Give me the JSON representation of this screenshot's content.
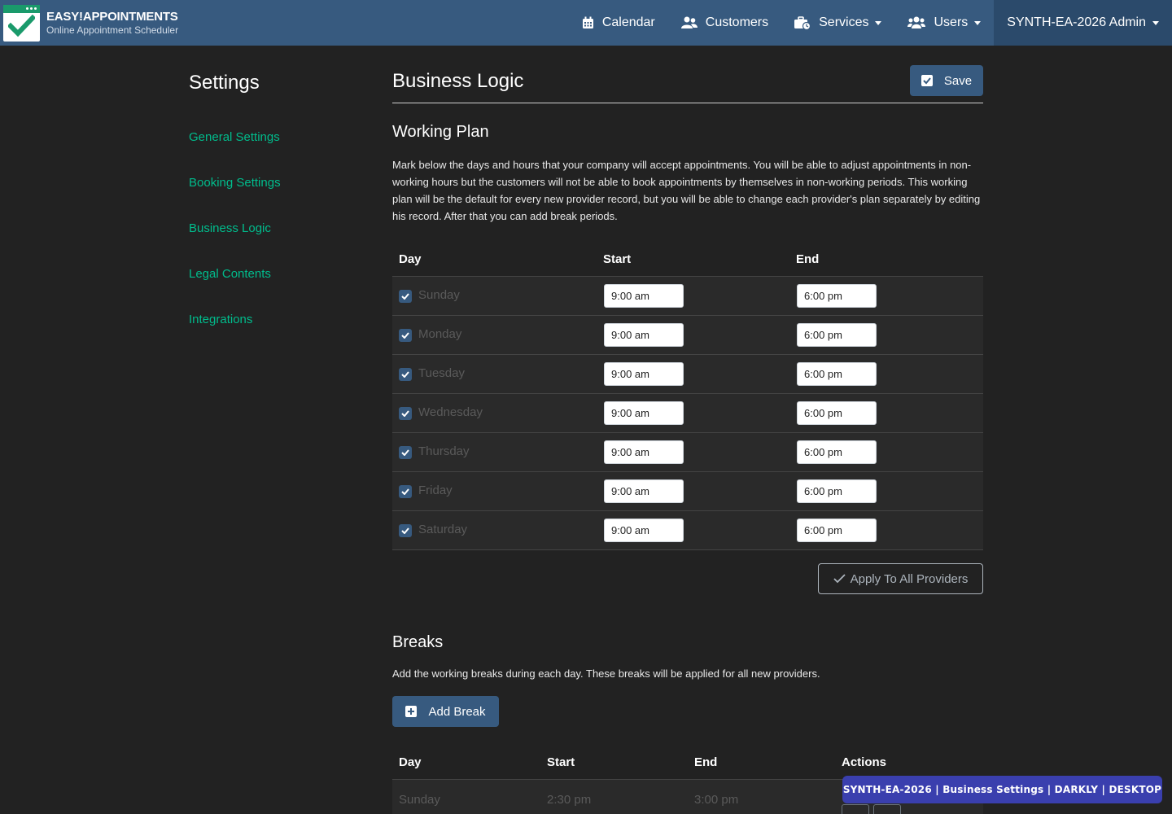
{
  "brand": {
    "title": "EASY!APPOINTMENTS",
    "subtitle": "Online Appointment Scheduler",
    "accent": "#1a9a6b"
  },
  "nav": {
    "items": [
      {
        "label": "Calendar",
        "icon": "calendar-icon",
        "dropdown": false
      },
      {
        "label": "Customers",
        "icon": "users-icon",
        "dropdown": false
      },
      {
        "label": "Services",
        "icon": "business-time-icon",
        "dropdown": true
      },
      {
        "label": "Users",
        "icon": "users-cog-icon",
        "dropdown": true
      },
      {
        "label": "SYNTH-EA-2026 Admin",
        "icon": "",
        "dropdown": true
      }
    ]
  },
  "sidebar": {
    "title": "Settings",
    "items": [
      {
        "label": "General Settings"
      },
      {
        "label": "Booking Settings"
      },
      {
        "label": "Business Logic"
      },
      {
        "label": "Legal Contents"
      },
      {
        "label": "Integrations"
      }
    ]
  },
  "main": {
    "title": "Business Logic",
    "save_label": "Save",
    "working_plan": {
      "heading": "Working Plan",
      "description": "Mark below the days and hours that your company will accept appointments. You will be able to adjust appointments in non-working hours but the customers will not be able to book appointments by themselves in non-working periods. This working plan will be the default for every new provider record, but you will be able to change each provider's plan separately by editing his record. After that you can add break periods.",
      "columns": [
        "Day",
        "Start",
        "End"
      ],
      "rows": [
        {
          "day": "Sunday",
          "checked": true,
          "start": "9:00 am",
          "end": "6:00 pm"
        },
        {
          "day": "Monday",
          "checked": true,
          "start": "9:00 am",
          "end": "6:00 pm"
        },
        {
          "day": "Tuesday",
          "checked": true,
          "start": "9:00 am",
          "end": "6:00 pm"
        },
        {
          "day": "Wednesday",
          "checked": true,
          "start": "9:00 am",
          "end": "6:00 pm"
        },
        {
          "day": "Thursday",
          "checked": true,
          "start": "9:00 am",
          "end": "6:00 pm"
        },
        {
          "day": "Friday",
          "checked": true,
          "start": "9:00 am",
          "end": "6:00 pm"
        },
        {
          "day": "Saturday",
          "checked": true,
          "start": "9:00 am",
          "end": "6:00 pm"
        }
      ],
      "apply_label": "Apply To All Providers"
    },
    "breaks": {
      "heading": "Breaks",
      "description": "Add the working breaks during each day. These breaks will be applied for all new providers.",
      "add_label": "Add Break",
      "columns": [
        "Day",
        "Start",
        "End",
        "Actions"
      ],
      "rows": [
        {
          "day": "Sunday",
          "start": "2:30 pm",
          "end": "3:00 pm"
        }
      ]
    }
  },
  "watermark": "SYNTH-EA-2026 | Business Settings | DARKLY | DESKTOP",
  "colors": {
    "navbar": "#375a7f",
    "background": "#222222",
    "link": "#00bc8c",
    "primary": "#375a7f"
  }
}
